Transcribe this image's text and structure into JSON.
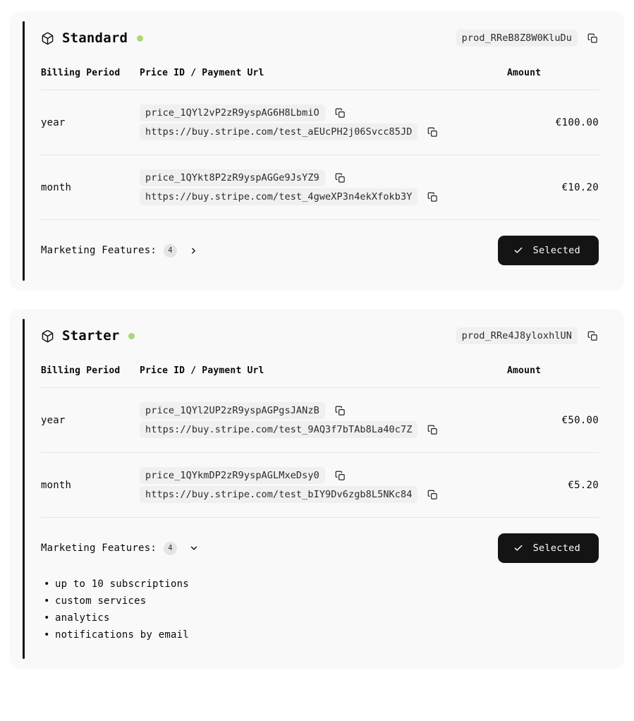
{
  "cards": [
    {
      "product_name": "Standard",
      "status_dot_color": "#a8d975",
      "product_id": "prod_RReB8Z8W0KluDu",
      "columns": {
        "period": "Billing Period",
        "price": "Price ID / Payment Url",
        "amount": "Amount"
      },
      "rows": [
        {
          "period": "year",
          "price_id": "price_1QYl2vP2zR9yspAG6H8LbmiO",
          "payment_url": "https://buy.stripe.com/test_aEUcPH2j06Svcc85JD",
          "amount": "€100.00"
        },
        {
          "period": "month",
          "price_id": "price_1QYkt8P2zR9yspAGGe9JsYZ9",
          "payment_url": "https://buy.stripe.com/test_4gweXP3n4ekXfokb3Y",
          "amount": "€10.20"
        }
      ],
      "features_label": "Marketing Features:",
      "features_count": "4",
      "features_expanded": false,
      "chevron_icon": "chevron-right-icon",
      "select_button_label": "Selected",
      "features": []
    },
    {
      "product_name": "Starter",
      "status_dot_color": "#a8d975",
      "product_id": "prod_RRe4J8yloxhlUN",
      "columns": {
        "period": "Billing Period",
        "price": "Price ID / Payment Url",
        "amount": "Amount"
      },
      "rows": [
        {
          "period": "year",
          "price_id": "price_1QYl2UP2zR9yspAGPgsJANzB",
          "payment_url": "https://buy.stripe.com/test_9AQ3f7bTAb8La40c7Z",
          "amount": "€50.00"
        },
        {
          "period": "month",
          "price_id": "price_1QYkmDP2zR9yspAGLMxeDsy0",
          "payment_url": "https://buy.stripe.com/test_bIY9Dv6zgb8L5NKc84",
          "amount": "€5.20"
        }
      ],
      "features_label": "Marketing Features:",
      "features_count": "4",
      "features_expanded": true,
      "chevron_icon": "chevron-down-icon",
      "select_button_label": "Selected",
      "features": [
        "up to 10 subscriptions",
        "custom services",
        "analytics",
        "notifications by email"
      ]
    }
  ]
}
